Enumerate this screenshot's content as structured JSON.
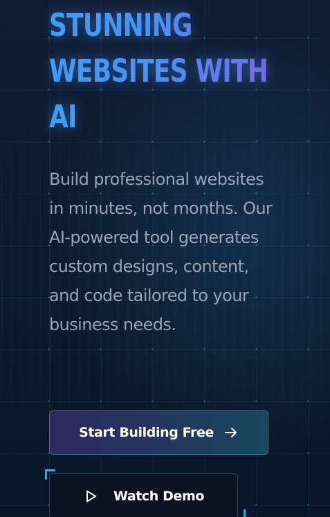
{
  "hero": {
    "headline_lines": [
      "STUNNING",
      "WEBSITES WITH",
      "AI"
    ],
    "description": "Build professional websites in minutes, not months. Our AI-powered tool generates custom designs, content, and code tailored to your business needs."
  },
  "cta": {
    "primary_label": "Start Building Free",
    "primary_icon": "arrow-right-icon",
    "secondary_label": "Watch Demo",
    "secondary_icon": "play-icon"
  },
  "colors": {
    "background": "#0c1a2e",
    "headline_gradient_start": "#3e9df5",
    "headline_gradient_end": "#7a66ea",
    "body_text": "#9aa3b5",
    "accent": "#2fa8e0",
    "button_text": "#ffffff"
  }
}
